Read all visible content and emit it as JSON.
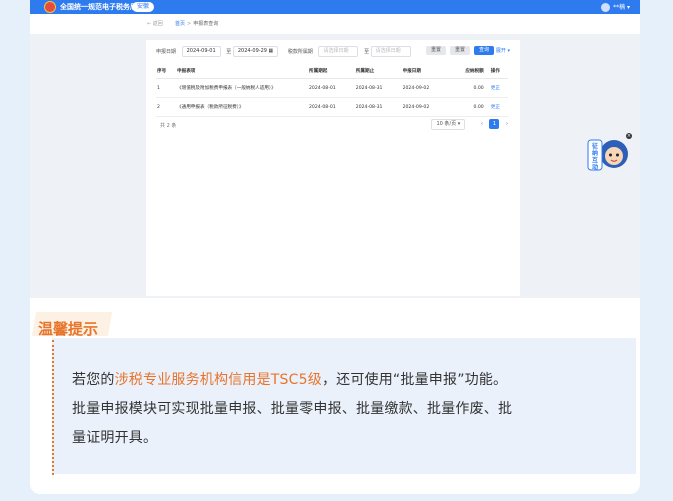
{
  "header": {
    "app_title": "全国统一规范电子税务局",
    "region": "安徽",
    "user": "**楠"
  },
  "breadcrumb": {
    "back": "返回",
    "home": "首页",
    "current": "申报表查询"
  },
  "filters": {
    "declare_date_label": "申报日期",
    "date_from": "2024-09-01",
    "range_sep": "至",
    "date_to": "2024-09-29",
    "period_label": "税款所属期",
    "period_from_placeholder": "请选择日期",
    "period_to_placeholder": "请选择日期",
    "reset": "重置",
    "clear": "重置",
    "query": "查询",
    "expand": "展开"
  },
  "table": {
    "headers": [
      "序号",
      "申报表项",
      "所属期起",
      "所属期止",
      "申报日期",
      "应纳税额",
      "操作"
    ],
    "rows": [
      {
        "no": "1",
        "name": "《增值税及附加税费申报表（一般纳税人适用）》",
        "start": "2024-08-01",
        "end": "2024-08-31",
        "date": "2024-09-02",
        "tax": "0.00",
        "action": "更正"
      },
      {
        "no": "2",
        "name": "《通用申报表（税款所征税费）》",
        "start": "2024-08-01",
        "end": "2024-08-31",
        "date": "2024-09-02",
        "tax": "0.00",
        "action": "更正"
      }
    ],
    "total": "共 2 条",
    "page_size": "10 条/页",
    "page": "1"
  },
  "mascot": {
    "text": "征纳互动"
  },
  "tip": {
    "title": "温馨提示",
    "line1_a": "若您的",
    "line1_hl": "涉税专业服务机构信用是TSC5级",
    "line1_b": "，还可使用“批量申报”功能。",
    "line2": "批量申报模块可实现批量申报、批量零申报、批量缴款、批量作废、批",
    "line3": "量证明开具。"
  }
}
